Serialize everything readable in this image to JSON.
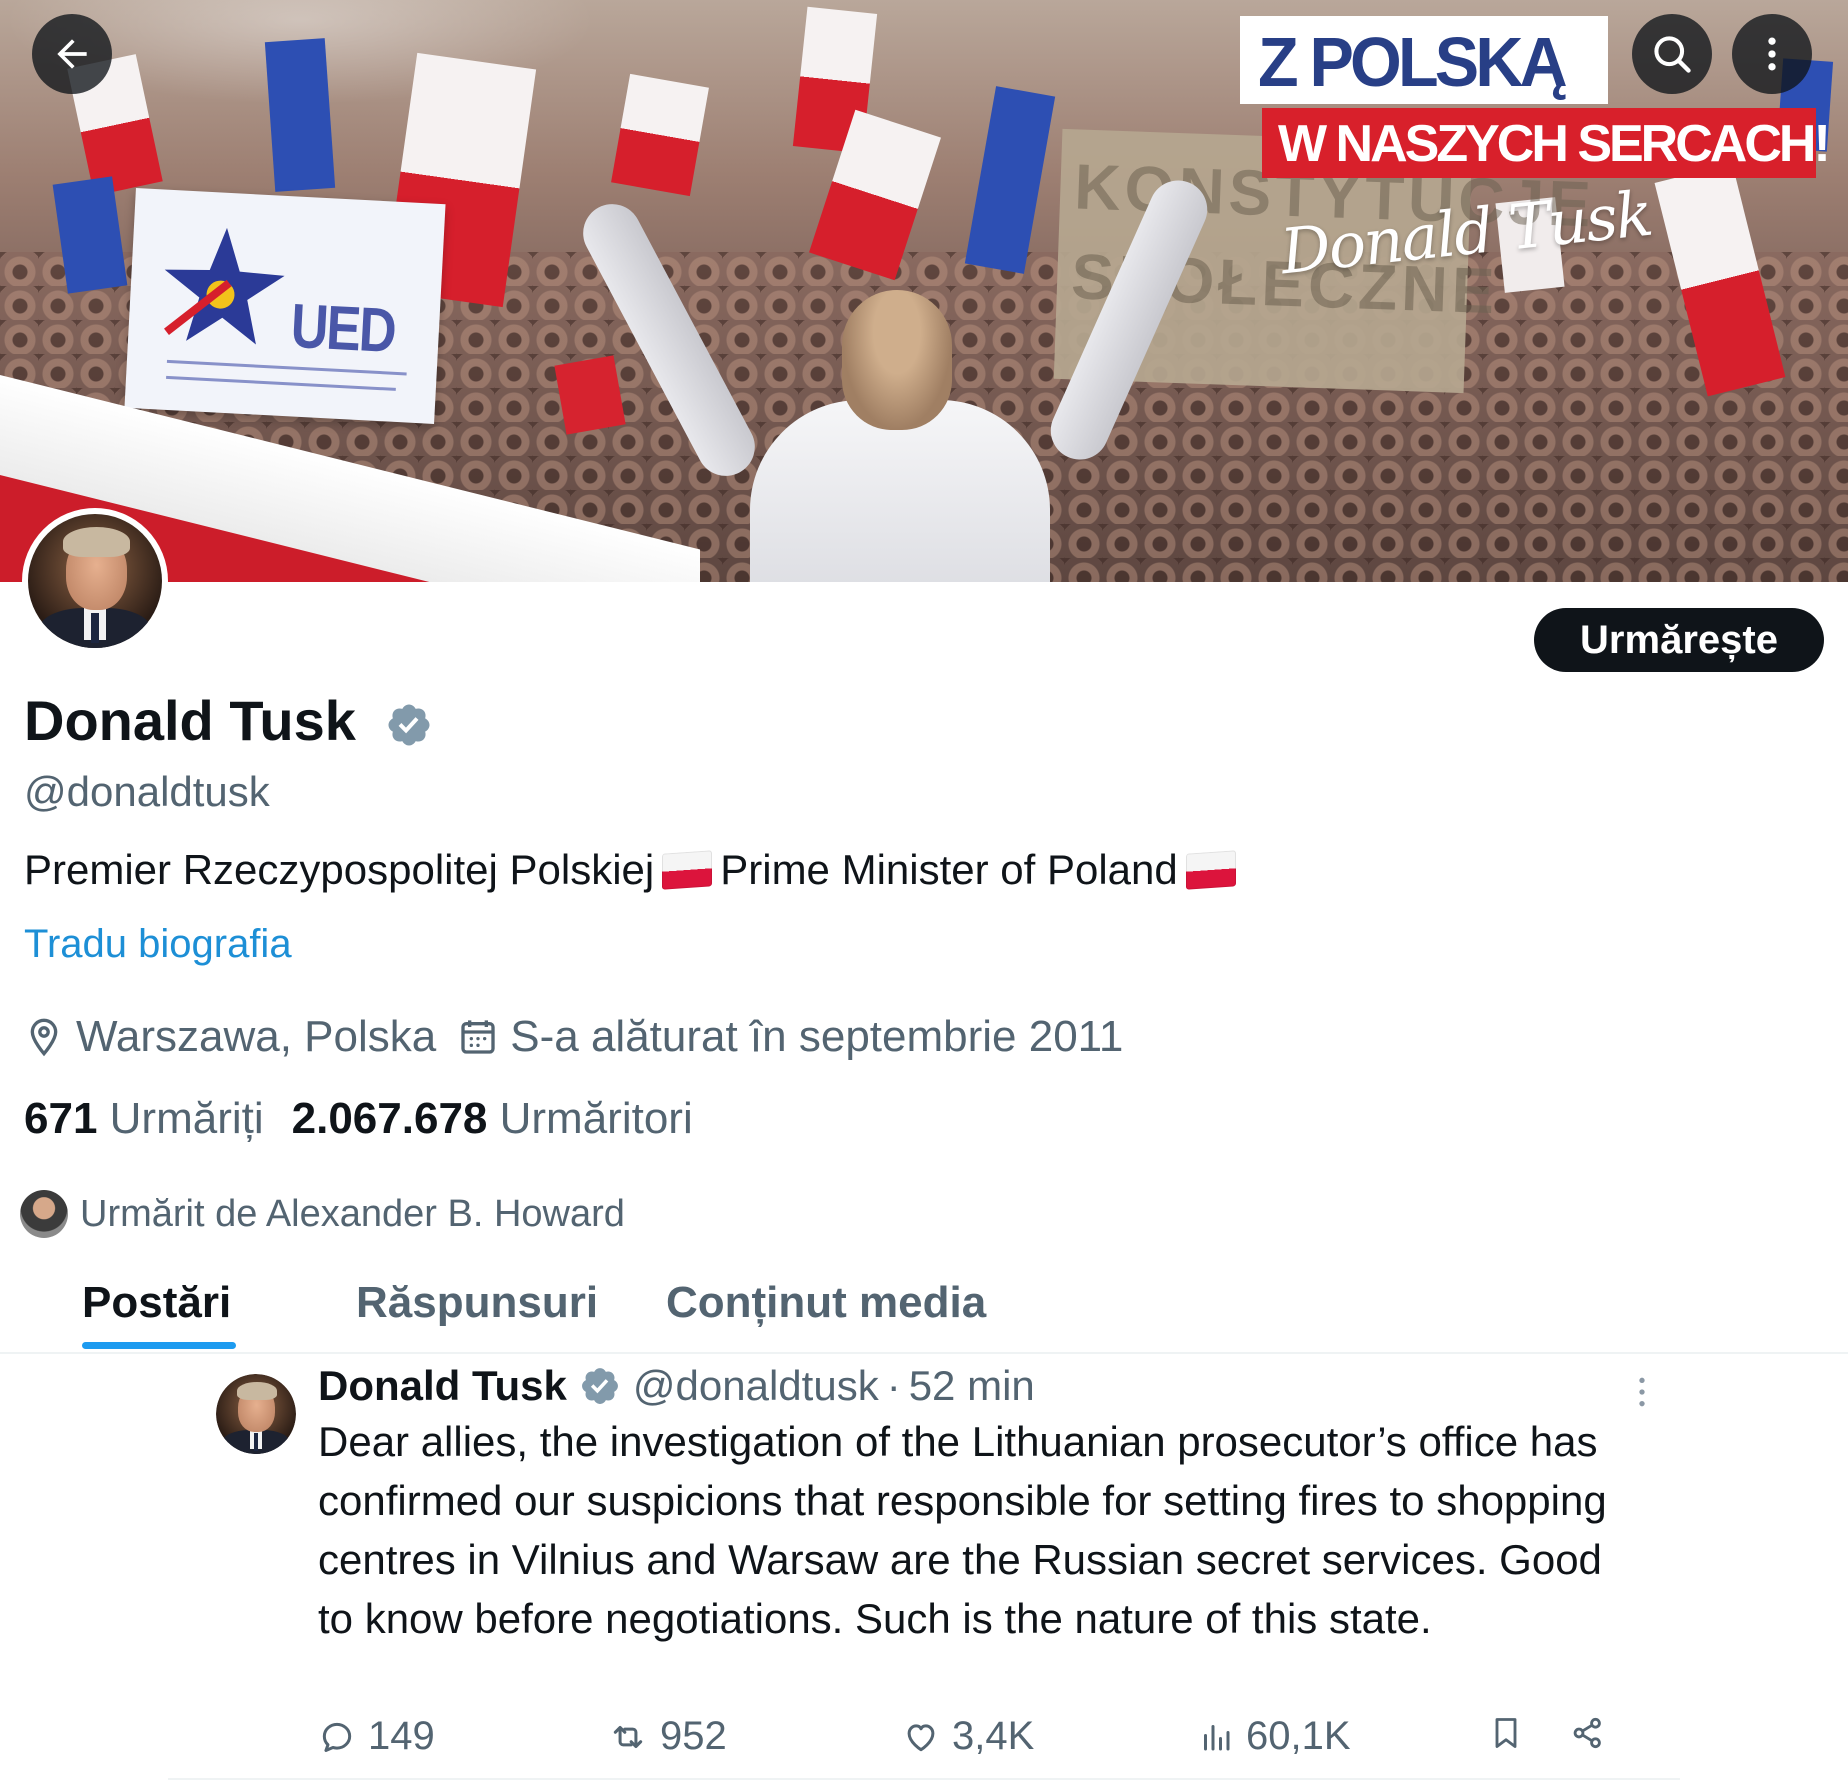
{
  "banner": {
    "logo_line1": "Z POLSKĄ",
    "logo_line2": "W NASZYCH SERCACH!",
    "signature": "Donald Tusk",
    "sign_text": "UED",
    "cardboard_text_1": "KONSTYTUCJE",
    "cardboard_text_2": "SPOŁECZNE"
  },
  "toolbar": {
    "back_icon": "arrow-left-icon",
    "search_icon": "search-icon",
    "more_icon": "more-vertical-icon"
  },
  "profile": {
    "follow_label": "Urmărește",
    "name": "Donald Tusk",
    "handle": "@donaldtusk",
    "bio_part1": "Premier Rzeczypospolitej Polskiej",
    "bio_part2": "Prime Minister of Poland",
    "translate_label": "Tradu biografia",
    "location": "Warszawa, Polska",
    "joined": "S-a alăturat în septembrie 2011",
    "following_count": "671",
    "following_label": "Urmăriți",
    "followers_count": "2.067.678",
    "followers_label": "Urmăritori",
    "followed_by": "Urmărit de Alexander B. Howard"
  },
  "tabs": [
    {
      "label": "Postări",
      "active": true
    },
    {
      "label": "Răspunsuri",
      "active": false
    },
    {
      "label": "Conținut media",
      "active": false
    }
  ],
  "tweet": {
    "author": "Donald Tusk",
    "handle": "@donaldtusk",
    "separator": "·",
    "time": "52 min",
    "text": "Dear allies, the investigation of the Lithuanian prosecutor’s office has confirmed our suspicions that responsible for setting fires to shopping centres in Vilnius and Warsaw are the Russian secret services. Good to know before negotiations. Such is the nature of this state.",
    "replies": "149",
    "reposts": "952",
    "likes": "3,4K",
    "views": "60,1K"
  },
  "colors": {
    "accent": "#1d9bf0",
    "text": "#0f1419",
    "muted": "#536471",
    "verified": "#829aab"
  }
}
